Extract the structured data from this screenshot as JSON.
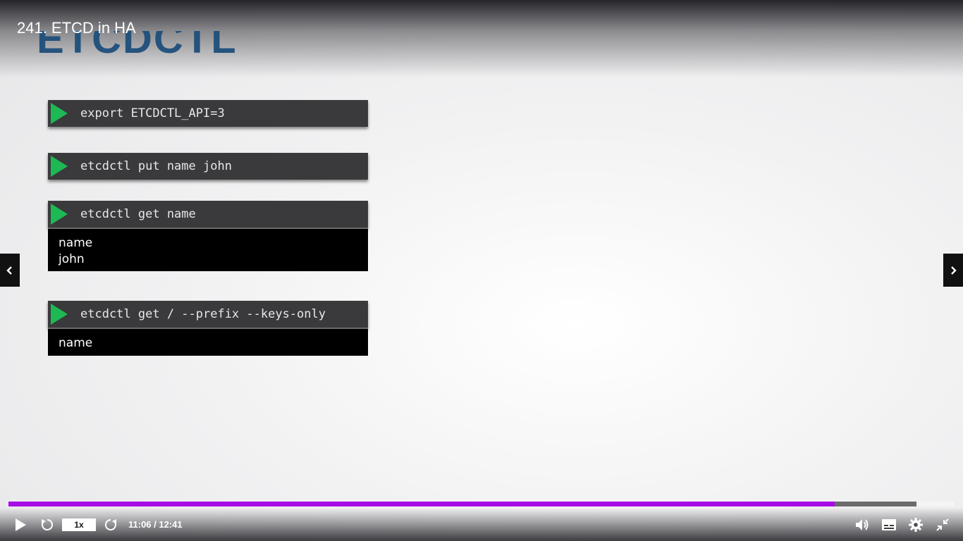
{
  "video": {
    "title": "241. ETCD in HA"
  },
  "slide": {
    "heading": "ETCDCTL",
    "commands": [
      {
        "command": "export ETCDCTL_API=3",
        "output": []
      },
      {
        "command": "etcdctl put name john",
        "output": []
      },
      {
        "command": "etcdctl get name",
        "output": [
          "name",
          "john"
        ]
      },
      {
        "command": "etcdctl get / --prefix --keys-only",
        "output": [
          "name"
        ]
      }
    ]
  },
  "player": {
    "speed_label": "1x",
    "time_display": "11:06 / 12:41",
    "progress_played": 0.873,
    "progress_buffered": 0.96,
    "accent_color": "#a70ce6",
    "icons": [
      "chevron-left-icon",
      "chevron-right-icon",
      "play-icon",
      "rewind-icon",
      "forward-icon",
      "volume-icon",
      "captions-icon",
      "settings-icon",
      "exit-fullscreen-icon"
    ]
  }
}
